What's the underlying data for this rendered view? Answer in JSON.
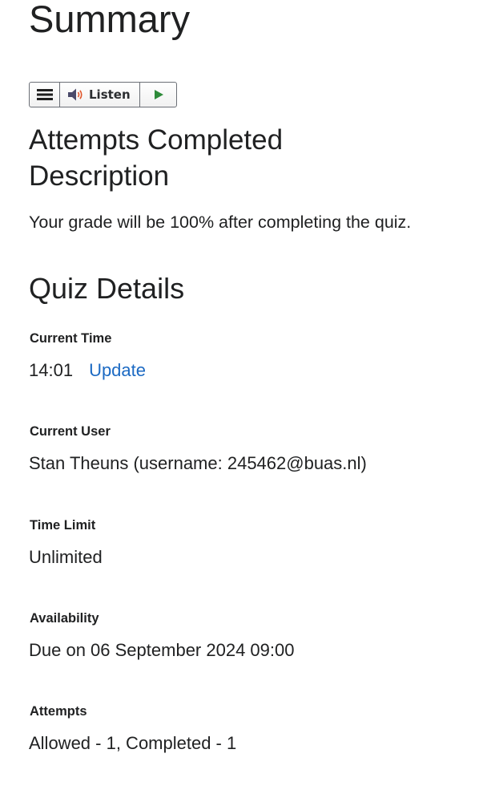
{
  "page": {
    "title": "Summary"
  },
  "listen_toolbar": {
    "menu_icon": "menu-icon",
    "speaker_icon": "speaker-icon",
    "listen_label": "Listen",
    "play_icon": "play-icon",
    "colors": {
      "play": "#2e8b3a",
      "speaker_body": "#4a4a6a",
      "speaker_waves": "#e0552a"
    }
  },
  "attempts_section": {
    "heading": "Attempts Completed Description",
    "description": "Your grade will be 100% after completing the quiz."
  },
  "quiz_details": {
    "heading": "Quiz Details",
    "current_time": {
      "label": "Current Time",
      "value": "14:01",
      "update_link": "Update"
    },
    "current_user": {
      "label": "Current User",
      "value": "Stan Theuns (username: 245462@buas.nl)"
    },
    "time_limit": {
      "label": "Time Limit",
      "value": "Unlimited"
    },
    "availability": {
      "label": "Availability",
      "value": "Due on 06 September 2024 09:00"
    },
    "attempts": {
      "label": "Attempts",
      "value": "Allowed - 1, Completed - 1"
    }
  },
  "colors": {
    "text": "#202122",
    "link": "#1c6ac3",
    "toolbar_border": "#6b6f76"
  }
}
